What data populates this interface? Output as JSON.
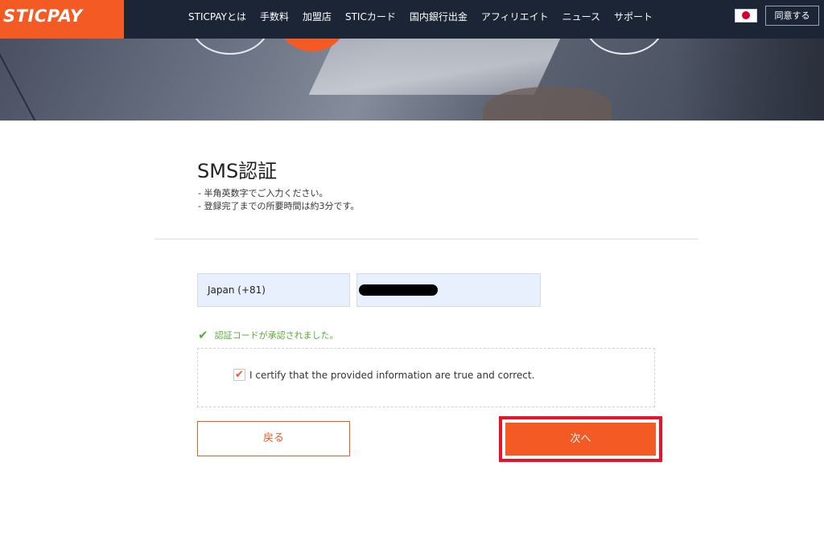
{
  "header": {
    "logo": "STICPAY",
    "nav": [
      "STICPAYとは",
      "手数料",
      "加盟店",
      "STICカード",
      "国内銀行出金",
      "アフィリエイト",
      "ニュース",
      "サポート"
    ],
    "language_flag_icon": "japan-flag-icon",
    "agree_button": "同意する"
  },
  "form": {
    "title": "SMS認証",
    "notes": [
      "- 半角英数字でご入力ください。",
      "- 登録完了までの所要時間は約3分です。"
    ],
    "country_value": "Japan (+81)",
    "phone_value_redacted": true,
    "verified_message": "認証コードが承認されました。",
    "certify_label": "I certify that the provided information are true and correct.",
    "certify_checked": true,
    "back_button": "戻る",
    "next_button": "次へ"
  },
  "colors": {
    "brand": "#f35a24",
    "nav_bg": "#1c2536",
    "success": "#5caa3c",
    "highlight": "#e8132a",
    "input_bg": "#e8f0fe"
  }
}
